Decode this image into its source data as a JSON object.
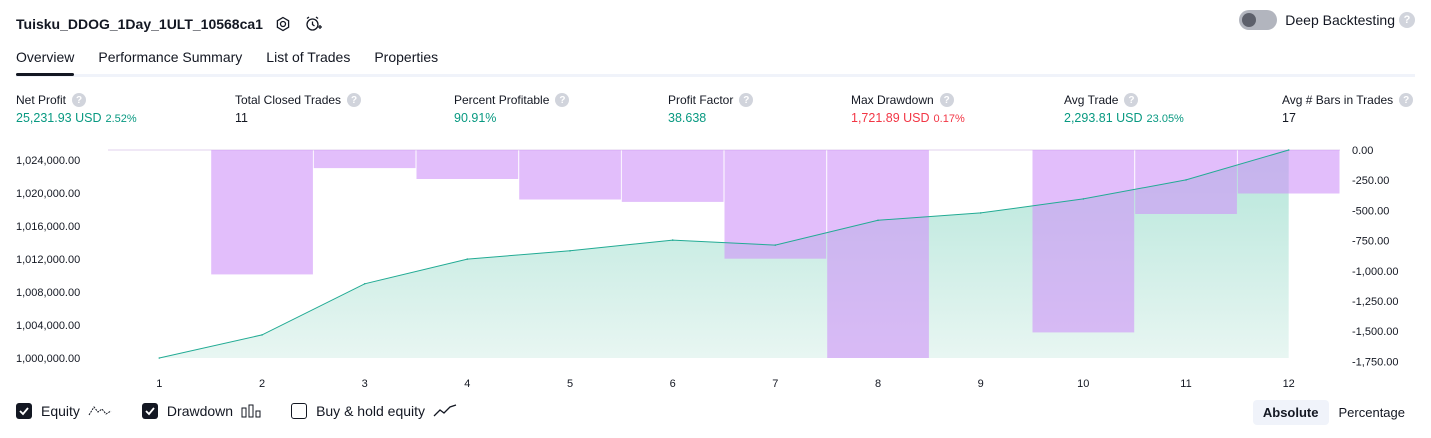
{
  "header": {
    "title": "Tuisku_DDOG_1Day_1ULT_10568ca1",
    "deep_backtesting_label": "Deep Backtesting",
    "help_glyph": "?"
  },
  "tabs": [
    {
      "label": "Overview"
    },
    {
      "label": "Performance Summary"
    },
    {
      "label": "List of Trades"
    },
    {
      "label": "Properties"
    }
  ],
  "stats": [
    {
      "label": "Net Profit",
      "value": "25,231.93 USD",
      "pct": "2.52%",
      "color": "#089981"
    },
    {
      "label": "Total Closed Trades",
      "value": "11",
      "pct": "",
      "color": "#131722"
    },
    {
      "label": "Percent Profitable",
      "value": "90.91%",
      "pct": "",
      "color": "#089981"
    },
    {
      "label": "Profit Factor",
      "value": "38.638",
      "pct": "",
      "color": "#089981"
    },
    {
      "label": "Max Drawdown",
      "value": "1,721.89 USD",
      "pct": "0.17%",
      "color": "#f23645"
    },
    {
      "label": "Avg Trade",
      "value": "2,293.81 USD",
      "pct": "23.05%",
      "color": "#089981"
    },
    {
      "label": "Avg # Bars in Trades",
      "value": "17",
      "pct": "",
      "color": "#131722"
    }
  ],
  "legend": {
    "equity_label": "Equity",
    "drawdown_label": "Drawdown",
    "buyhold_label": "Buy & hold equity",
    "equity_checked": true,
    "drawdown_checked": true,
    "buyhold_checked": false
  },
  "modes": {
    "absolute": "Absolute",
    "percentage": "Percentage",
    "active": "absolute"
  },
  "colors": {
    "equity_line": "#22ab94",
    "equity_fill": "#d9f2ec",
    "drawdown_fill": "#ce93f8",
    "drawdown_opacity": 0.6
  },
  "chart_data": {
    "type": "area",
    "x": [
      1,
      2,
      3,
      4,
      5,
      6,
      7,
      8,
      9,
      10,
      11,
      12
    ],
    "x_ticks": [
      "1",
      "2",
      "3",
      "4",
      "5",
      "6",
      "7",
      "8",
      "9",
      "10",
      "11",
      "12"
    ],
    "series": [
      {
        "name": "Equity",
        "axis": "left",
        "values": [
          1000000,
          1002800,
          1009000,
          1012000,
          1013000,
          1014300,
          1013700,
          1016700,
          1017600,
          1019300,
          1021600,
          1025231.93
        ]
      },
      {
        "name": "Drawdown",
        "axis": "right",
        "type": "bar",
        "values": [
          0,
          -1030,
          -150,
          -240,
          -410,
          -430,
          -900,
          -1721.89,
          0,
          -1510,
          -530,
          -360
        ]
      }
    ],
    "y_left_ticks": [
      "1,000,000.00",
      "1,004,000.00",
      "1,008,000.00",
      "1,012,000.00",
      "1,016,000.00",
      "1,020,000.00",
      "1,024,000.00"
    ],
    "y_left_values": [
      1000000,
      1004000,
      1008000,
      1012000,
      1016000,
      1020000,
      1024000
    ],
    "y_left_range": [
      1000000,
      1025231.93
    ],
    "y_right_ticks": [
      "0.00",
      "-250.00",
      "-500.00",
      "-750.00",
      "-1,000.00",
      "-1,250.00",
      "-1,500.00",
      "-1,750.00"
    ],
    "y_right_values": [
      0,
      -250,
      -500,
      -750,
      -1000,
      -1250,
      -1500,
      -1750
    ],
    "y_right_range": [
      0,
      -1721.89
    ]
  }
}
